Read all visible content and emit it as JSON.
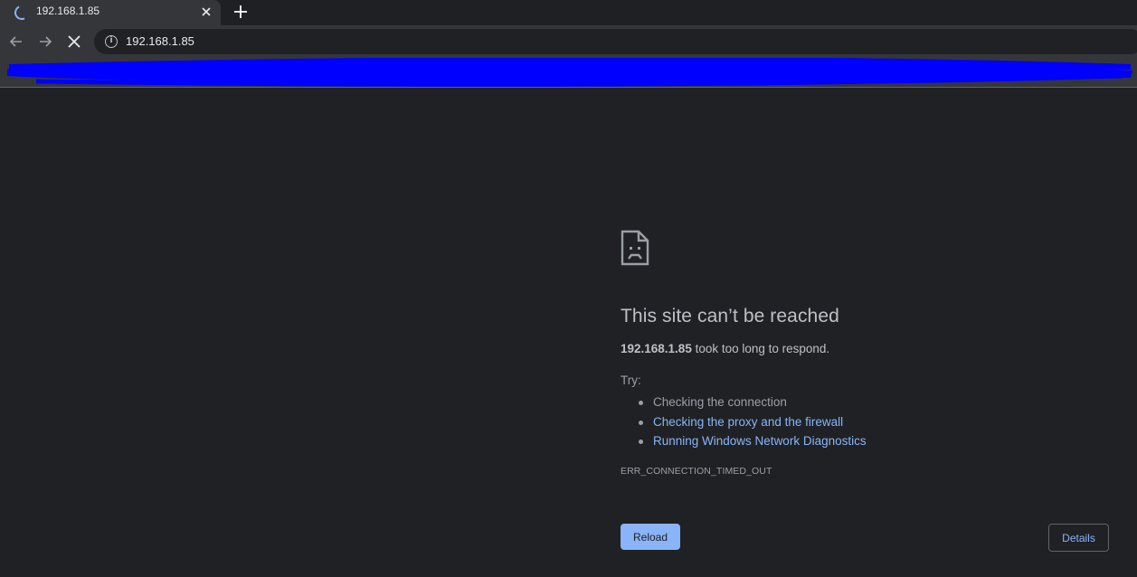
{
  "tab": {
    "title": "192.168.1.85",
    "close_icon": "close-icon",
    "loading_icon": "spinner-icon"
  },
  "new_tab": {
    "label": "+",
    "icon": "plus-icon"
  },
  "toolbar": {
    "back_icon": "arrow-left-icon",
    "forward_icon": "arrow-right-icon",
    "stop_icon": "stop-x-icon",
    "site_info_icon": "info-icon",
    "url": "192.168.1.85"
  },
  "bookmarks_bar": {
    "redaction_color": "#0000ff"
  },
  "error": {
    "icon": "sad-page-icon",
    "headline": "This site can’t be reached",
    "host": "192.168.1.85",
    "summary_rest": " took too long to respond.",
    "try_label": "Try:",
    "suggestions": [
      "Checking the connection",
      "Checking the proxy and the firewall",
      "Running Windows Network Diagnostics"
    ],
    "code": "ERR_CONNECTION_TIMED_OUT",
    "reload_label": "Reload",
    "details_label": "Details"
  },
  "colors": {
    "background": "#202124",
    "link": "#8ab4f8",
    "text": "#bdc1c6",
    "chrome": "#35363a"
  }
}
